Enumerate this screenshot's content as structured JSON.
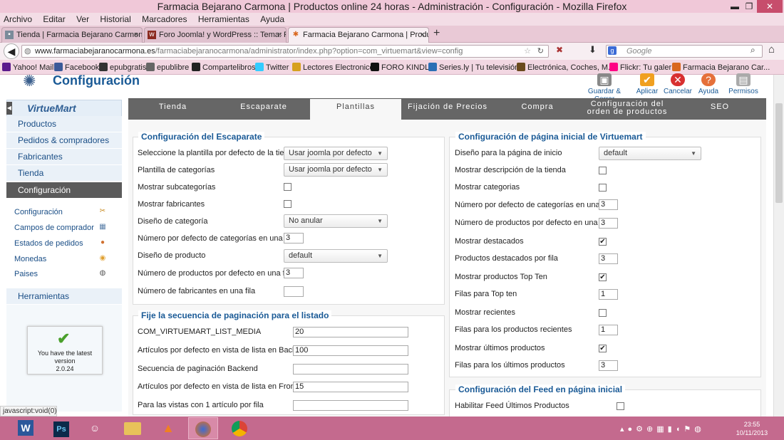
{
  "window": {
    "title": "Farmacia Bejarano Carmona | Productos online 24 horas - Administración - Configuración - Mozilla Firefox"
  },
  "menu": [
    "Archivo",
    "Editar",
    "Ver",
    "Historial",
    "Marcadores",
    "Herramientas",
    "Ayuda"
  ],
  "tabs": [
    {
      "label": "Tienda | Farmacia Bejarano Carmona",
      "close": "×"
    },
    {
      "label": "Foro Joomla! y WordPress :: Tema: Pa...",
      "close": "×"
    },
    {
      "label": "Farmacia Bejarano Carmona | Produc...",
      "close": "×"
    }
  ],
  "new_tab": "+",
  "url": {
    "host": "www.farmaciabejaranocarmona.es",
    "path": "/farmaciabejaranocarmona/administrator/index.php?option=com_virtuemart&view=config"
  },
  "search": {
    "placeholder": "Google"
  },
  "bookmarks": [
    "Yahoo! Mail",
    "Facebook",
    "epubgratis",
    "epublibre",
    "Compartelibros",
    "Twitter",
    "Lectores Electronicos",
    "FORO KINDLE",
    "Series.ly | Tu televisión...",
    "Electrónica, Coches, M...",
    "Flickr: Tu galería",
    "Farmacia Bejarano Car..."
  ],
  "header": {
    "title": "Configuración"
  },
  "toolbar": {
    "save_close": "Guardar & Cerrar",
    "apply": "Aplicar",
    "cancel": "Cancelar",
    "help": "Ayuda",
    "permissions": "Permisos"
  },
  "sidebar": {
    "logo": "VirtueMart",
    "nav": [
      "Productos",
      "Pedidos & compradores",
      "Fabricantes",
      "Tienda",
      "Configuración"
    ],
    "sub": [
      "Configuración",
      "Campos de comprador",
      "Estados de pedidos",
      "Monedas",
      "Paises"
    ],
    "tools": "Herramientas",
    "latest": {
      "line1": "You have the latest",
      "line2": "version",
      "version": "2.0.24"
    }
  },
  "config_tabs": [
    "Tienda",
    "Escaparate",
    "Plantillas",
    "Fijación de Precios",
    "Compra",
    "Configuración del orden de productos",
    "SEO"
  ],
  "escaparate": {
    "legend": "Configuración del Escaparate",
    "rows": [
      {
        "label": "Seleccione la plantilla por defecto de la tienda",
        "value": "Usar joomla por defecto"
      },
      {
        "label": "Plantilla de categorías",
        "value": "Usar joomla por defecto"
      },
      {
        "label": "Mostrar subcategorías",
        "value": ""
      },
      {
        "label": "Mostrar fabricantes",
        "value": ""
      },
      {
        "label": "Diseño de categoría",
        "value": "No anular"
      },
      {
        "label": "Número por defecto de categorías en una fila",
        "value": "3"
      },
      {
        "label": "Diseño de producto",
        "value": "default"
      },
      {
        "label": "Número de productos por defecto en una fila",
        "value": "3"
      },
      {
        "label": "Número de fabricantes en una fila",
        "value": ""
      }
    ]
  },
  "paginacion": {
    "legend": "Fije la secuencia de paginación para el listado",
    "rows": [
      {
        "label": "COM_VIRTUEMART_LIST_MEDIA",
        "value": "20"
      },
      {
        "label": "Artículos por defecto en vista de lista en Backend",
        "value": "100"
      },
      {
        "label": "Secuencia de paginación Backend",
        "value": ""
      },
      {
        "label": "Artículos por defecto en vista de lista en Frontend",
        "value": "15"
      },
      {
        "label": "Para las vistas con 1 artículo por fila",
        "value": ""
      }
    ]
  },
  "inicio": {
    "legend": "Configuración de página inicial de Virtuemart",
    "rows": [
      {
        "label": "Diseño para la página de inicio",
        "value": "default"
      },
      {
        "label": "Mostrar descripción de la tienda",
        "value": ""
      },
      {
        "label": "Mostrar categorias",
        "value": ""
      },
      {
        "label": "Número por defecto de categorías en una fila",
        "value": "3"
      },
      {
        "label": "Número de productos por defecto en una fila",
        "value": "3"
      },
      {
        "label": "Mostrar destacados",
        "value": "✔"
      },
      {
        "label": "Productos destacados por fila",
        "value": "3"
      },
      {
        "label": "Mostrar productos Top Ten",
        "value": "✔"
      },
      {
        "label": "Filas para Top ten",
        "value": "1"
      },
      {
        "label": "Mostrar recientes",
        "value": ""
      },
      {
        "label": "Filas para los productos recientes",
        "value": "1"
      },
      {
        "label": "Mostrar últimos productos",
        "value": "✔"
      },
      {
        "label": "Filas para los últimos productos",
        "value": "3"
      }
    ]
  },
  "feed": {
    "legend": "Configuración del Feed en página inicial",
    "row": {
      "label": "Habilitar Feed Últimos Productos",
      "value": ""
    }
  },
  "status": "javascript:void(0)",
  "clock": {
    "time": "23:55",
    "date": "10/11/2013"
  }
}
